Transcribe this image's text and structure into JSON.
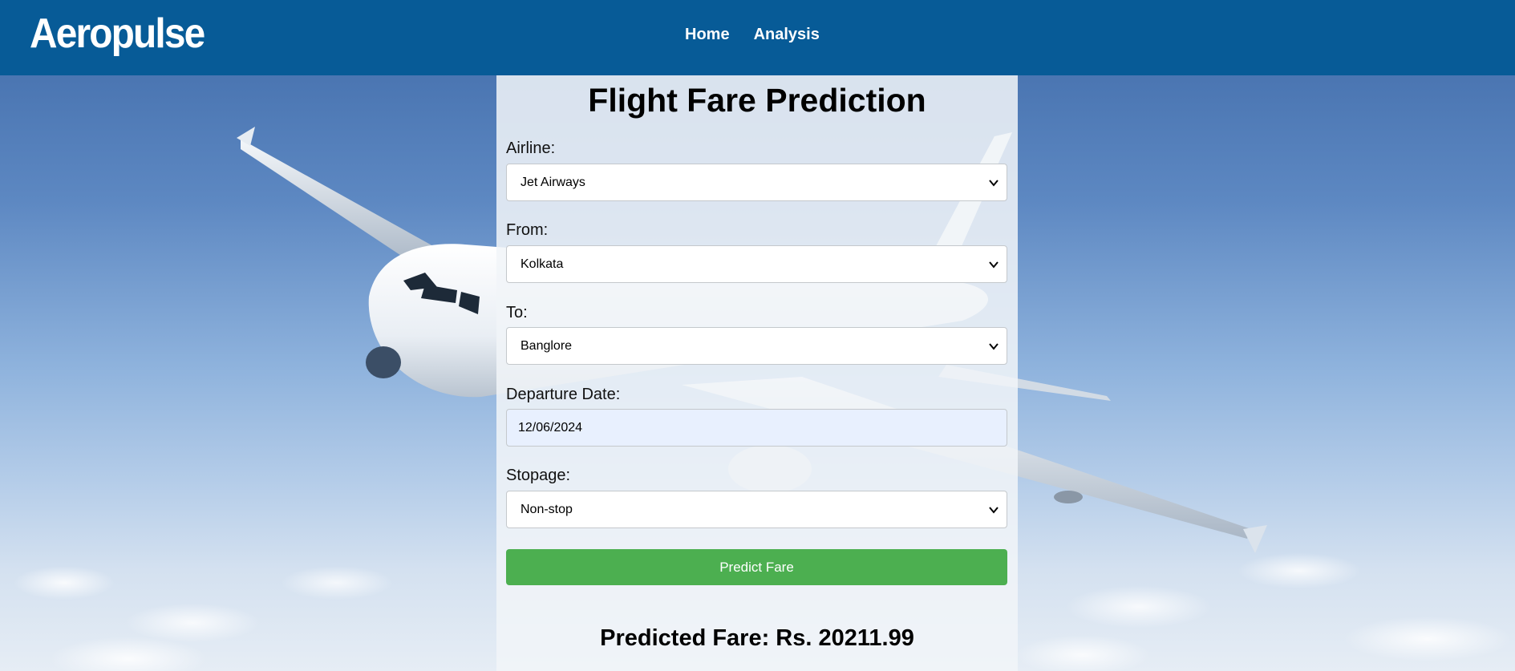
{
  "brand": "Aeropulse",
  "nav": {
    "items": [
      "Home",
      "Analysis"
    ]
  },
  "form": {
    "title": "Flight Fare Prediction",
    "airline": {
      "label": "Airline:",
      "value": "Jet Airways"
    },
    "from": {
      "label": "From:",
      "value": "Kolkata"
    },
    "to": {
      "label": "To:",
      "value": "Banglore"
    },
    "departure": {
      "label": "Departure Date:",
      "value": "12/06/2024"
    },
    "stopage": {
      "label": "Stopage:",
      "value": "Non-stop"
    },
    "submit_label": "Predict Fare"
  },
  "result": {
    "text": "Predicted Fare: Rs. 20211.99"
  },
  "colors": {
    "navbar": "#075b97",
    "button": "#4caf50",
    "date_field_bg": "#e8f0fe"
  },
  "icons": {
    "select_arrow": "chevron-down-icon"
  }
}
